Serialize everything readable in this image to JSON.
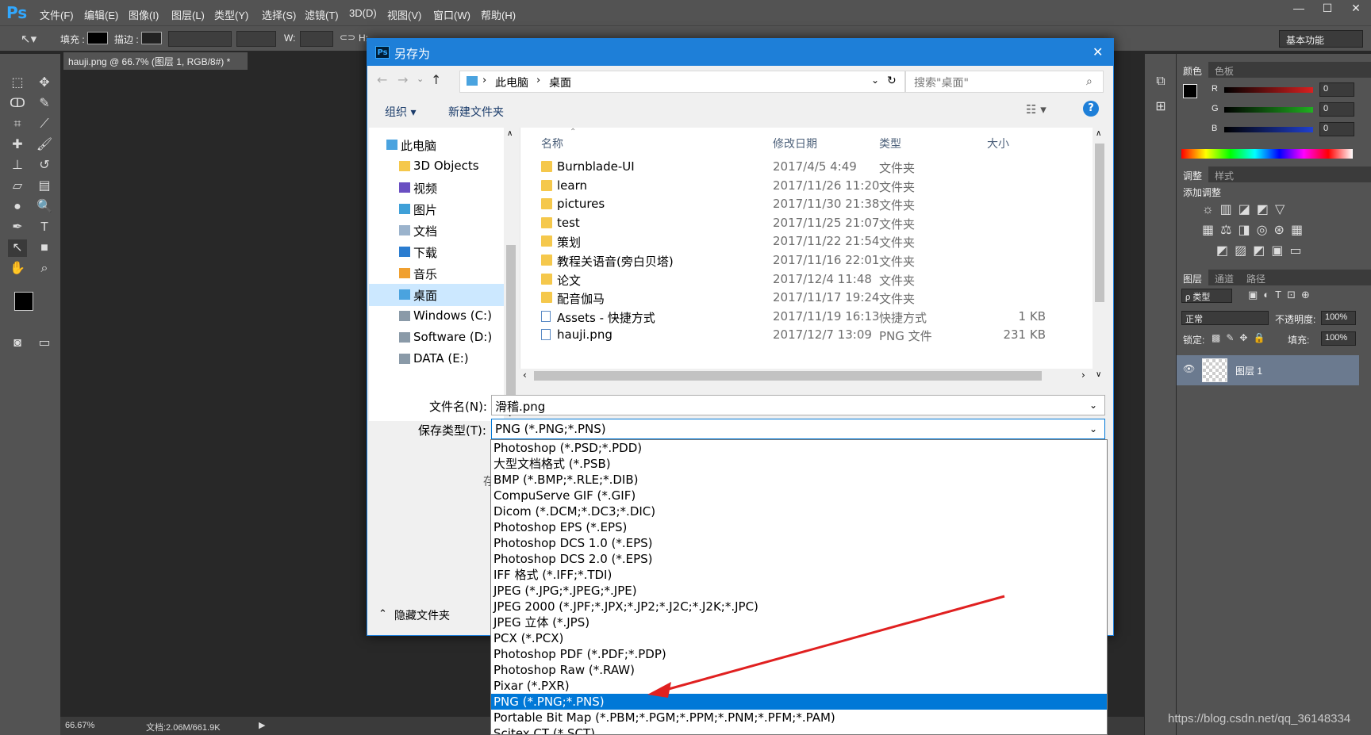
{
  "app": {
    "logo": "Ps",
    "menu": [
      "文件(F)",
      "编辑(E)",
      "图像(I)",
      "图层(L)",
      "类型(Y)",
      "选择(S)",
      "滤镜(T)",
      "3D(D)",
      "视图(V)",
      "窗口(W)",
      "帮助(H)"
    ],
    "options": {
      "fill_label": "填充 :",
      "stroke_label": "描边 :",
      "w_label": "W:",
      "h_label": "H:",
      "workspace": "基本功能"
    },
    "doc_tab": "hauji.png @ 66.7% (图层 1, RGB/8#) *",
    "status": {
      "zoom": "66.67%",
      "doc_info": "文档:2.06M/661.9K"
    },
    "panels": {
      "color": {
        "tabs": [
          "颜色",
          "色板"
        ],
        "channels": [
          {
            "name": "R",
            "value": "0",
            "color": "#d92020"
          },
          {
            "name": "G",
            "value": "0",
            "color": "#20b020"
          },
          {
            "name": "B",
            "value": "0",
            "color": "#2040d0"
          }
        ]
      },
      "adjust": {
        "tabs": [
          "调整",
          "样式"
        ],
        "title": "添加调整"
      },
      "layers": {
        "tabs": [
          "图层",
          "通道",
          "路径"
        ],
        "kind": "ρ 类型",
        "blend": "正常",
        "opacity_label": "不透明度:",
        "opacity": "100%",
        "lock_label": "锁定:",
        "fill_label": "填充:",
        "fill": "100%",
        "layer_name": "图层 1"
      }
    }
  },
  "dialog": {
    "title": "另存为",
    "breadcrumb": [
      "此电脑",
      "桌面"
    ],
    "search_placeholder": "搜索\"桌面\"",
    "toolbar": {
      "organize": "组织 ▾",
      "new_folder": "新建文件夹"
    },
    "nav": [
      {
        "label": "此电脑",
        "indent": 0,
        "icon": "pc-icon"
      },
      {
        "label": "3D Objects",
        "indent": 1,
        "icon": "folder-icon"
      },
      {
        "label": "视频",
        "indent": 1,
        "icon": "video-icon"
      },
      {
        "label": "图片",
        "indent": 1,
        "icon": "image-icon"
      },
      {
        "label": "文档",
        "indent": 1,
        "icon": "document-icon"
      },
      {
        "label": "下载",
        "indent": 1,
        "icon": "download-icon"
      },
      {
        "label": "音乐",
        "indent": 1,
        "icon": "music-icon"
      },
      {
        "label": "桌面",
        "indent": 1,
        "icon": "desktop-icon",
        "selected": true
      },
      {
        "label": "Windows (C:)",
        "indent": 1,
        "icon": "drive-icon"
      },
      {
        "label": "Software (D:)",
        "indent": 1,
        "icon": "drive-icon"
      },
      {
        "label": "DATA (E:)",
        "indent": 1,
        "icon": "drive-icon"
      }
    ],
    "columns": [
      "名称",
      "修改日期",
      "类型",
      "大小"
    ],
    "files": [
      {
        "name": "Burnblade-UI",
        "date": "2017/4/5 4:49",
        "type": "文件夹",
        "size": ""
      },
      {
        "name": "learn",
        "date": "2017/11/26 11:20",
        "type": "文件夹",
        "size": ""
      },
      {
        "name": "pictures",
        "date": "2017/11/30 21:38",
        "type": "文件夹",
        "size": ""
      },
      {
        "name": "test",
        "date": "2017/11/25 21:07",
        "type": "文件夹",
        "size": ""
      },
      {
        "name": "策划",
        "date": "2017/11/22 21:54",
        "type": "文件夹",
        "size": ""
      },
      {
        "name": "教程关语音(旁白贝塔)",
        "date": "2017/11/16 22:01",
        "type": "文件夹",
        "size": ""
      },
      {
        "name": "论文",
        "date": "2017/12/4 11:48",
        "type": "文件夹",
        "size": ""
      },
      {
        "name": "配音伽马",
        "date": "2017/11/17 19:24",
        "type": "文件夹",
        "size": ""
      },
      {
        "name": "Assets - 快捷方式",
        "date": "2017/11/19 16:13",
        "type": "快捷方式",
        "size": "1 KB"
      },
      {
        "name": "hauji.png",
        "date": "2017/12/7 13:09",
        "type": "PNG 文件",
        "size": "231 KB"
      }
    ],
    "filename_label": "文件名(N):",
    "filename": "滑稽.png",
    "filetype_label": "保存类型(T):",
    "filetype": "PNG (*.PNG;*.PNS)",
    "hide_folders": "隐藏文件夹",
    "partial_label": "存",
    "type_options": [
      "Photoshop (*.PSD;*.PDD)",
      "大型文档格式 (*.PSB)",
      "BMP (*.BMP;*.RLE;*.DIB)",
      "CompuServe GIF (*.GIF)",
      "Dicom (*.DCM;*.DC3;*.DIC)",
      "Photoshop EPS (*.EPS)",
      "Photoshop DCS 1.0 (*.EPS)",
      "Photoshop DCS 2.0 (*.EPS)",
      "IFF 格式 (*.IFF;*.TDI)",
      "JPEG (*.JPG;*.JPEG;*.JPE)",
      "JPEG 2000 (*.JPF;*.JPX;*.JP2;*.J2C;*.J2K;*.JPC)",
      "JPEG 立体 (*.JPS)",
      "PCX (*.PCX)",
      "Photoshop PDF (*.PDF;*.PDP)",
      "Photoshop Raw (*.RAW)",
      "Pixar (*.PXR)",
      "PNG (*.PNG;*.PNS)",
      "Portable Bit Map (*.PBM;*.PGM;*.PPM;*.PNM;*.PFM;*.PAM)",
      "Scitex CT (*.SCT)"
    ],
    "selected_option_index": 16
  },
  "watermark": "https://blog.csdn.net/qq_36148334",
  "annotation": {
    "arrow_color": "#e02020"
  }
}
